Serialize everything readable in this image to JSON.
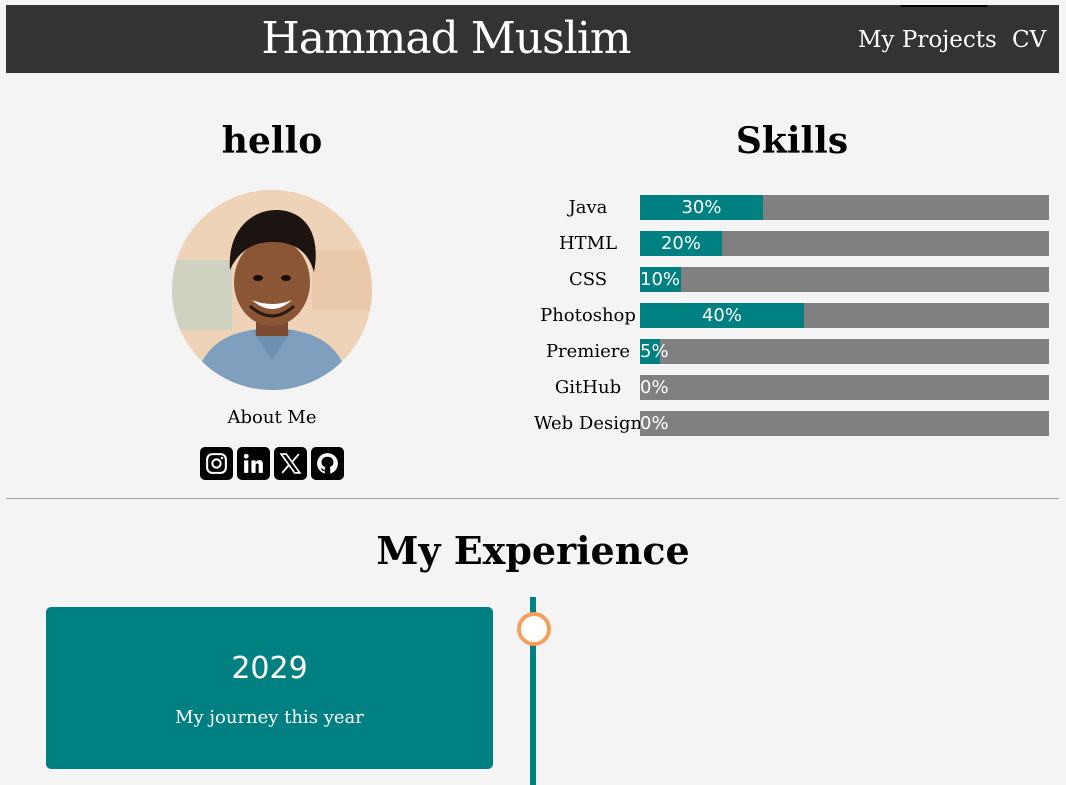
{
  "header": {
    "title": "Hammad Muslim",
    "nav": [
      {
        "label": "My Projects"
      },
      {
        "label": "CV"
      }
    ]
  },
  "profile": {
    "heading": "hello",
    "about_label": "About Me",
    "socials": [
      "instagram-icon",
      "linkedin-icon",
      "x-icon",
      "github-icon"
    ]
  },
  "skills": {
    "heading": "Skills",
    "items": [
      {
        "name": "Java",
        "percent_label": "30%",
        "level": 30
      },
      {
        "name": "HTML",
        "percent_label": "20%",
        "level": 20
      },
      {
        "name": "CSS",
        "percent_label": "10%",
        "level": 10
      },
      {
        "name": "Photoshop",
        "percent_label": "40%",
        "level": 40
      },
      {
        "name": "Premiere",
        "percent_label": "5%",
        "level": 5
      },
      {
        "name": "GitHub",
        "percent_label": "0%",
        "level": 0
      },
      {
        "name": "Web Design",
        "percent_label": "0%",
        "level": 0
      }
    ]
  },
  "experience": {
    "heading": "My Experience",
    "cards": [
      {
        "year": "2029",
        "text": "My journey this year"
      }
    ]
  },
  "colors": {
    "header_bg": "#333333",
    "accent": "#008080",
    "track": "#808080",
    "timeline_dot": "#f5a05a",
    "page_bg": "#f4f4f4"
  }
}
